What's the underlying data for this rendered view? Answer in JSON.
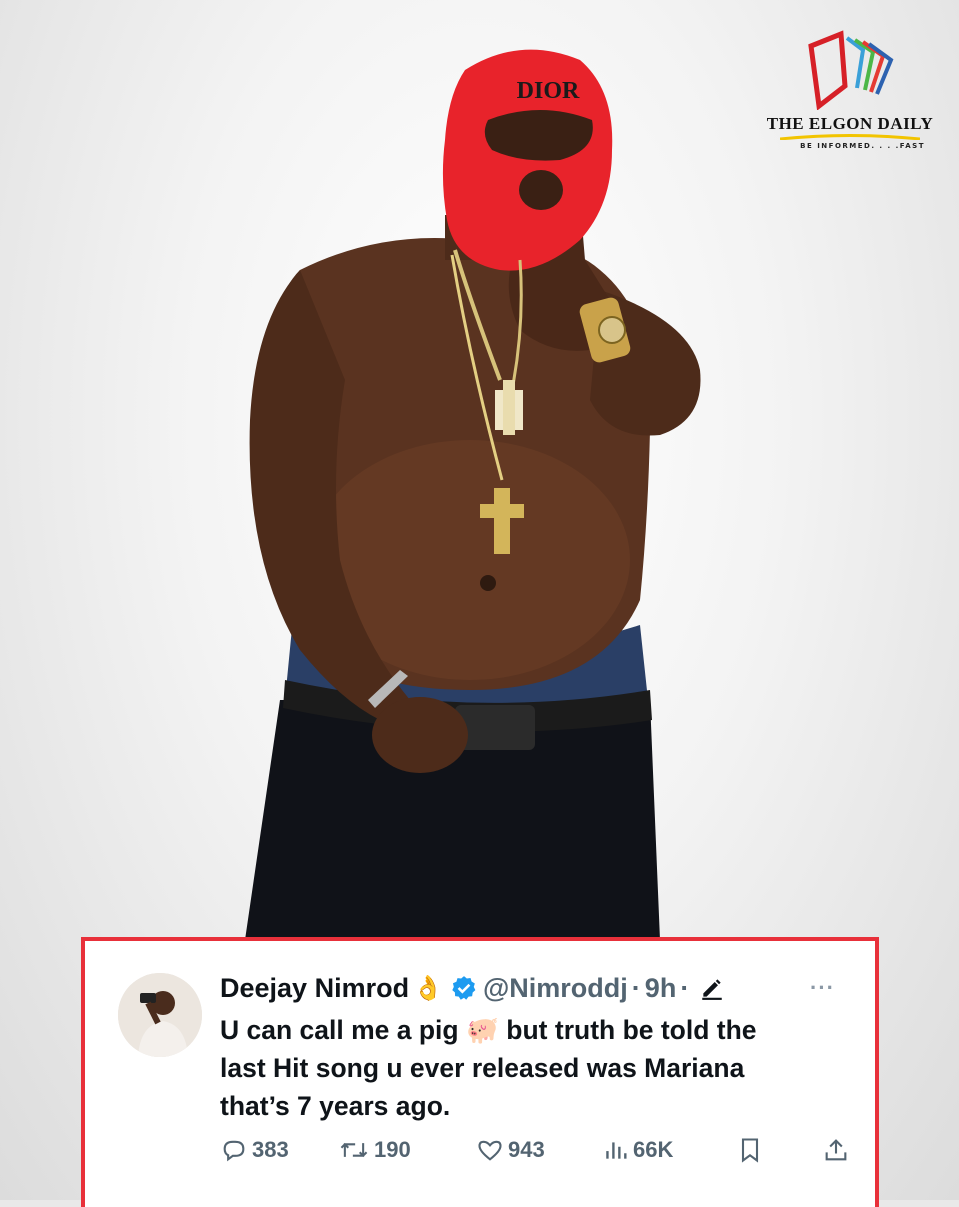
{
  "logo": {
    "name": "THE ELGON DAILY",
    "tagline": "BE INFORMED. . . .FAST"
  },
  "photo": {
    "mask_brand": "DIOR",
    "mask_color": "#e8232b",
    "background_color": "#f3f3f3"
  },
  "tweet": {
    "border_color": "#e8303a",
    "display_name": "Deejay Nimrod",
    "name_emoji": "👌",
    "verified_icon": "verified-badge-icon",
    "handle": "@Nimroddj",
    "separator": "·",
    "time": "9h",
    "more": "···",
    "text_line_1": "U can call me a pig 🐖  but truth be told the",
    "text_line_2": "last Hit song u ever released was Mariana",
    "text_line_3": "that’s 7 years ago.",
    "metrics": {
      "replies": "383",
      "retweets": "190",
      "likes": "943",
      "views": "66K"
    },
    "icons": {
      "reply": "reply-icon",
      "retweet": "retweet-icon",
      "like": "heart-icon",
      "views": "views-icon",
      "bookmark": "bookmark-icon",
      "share": "share-icon"
    }
  }
}
